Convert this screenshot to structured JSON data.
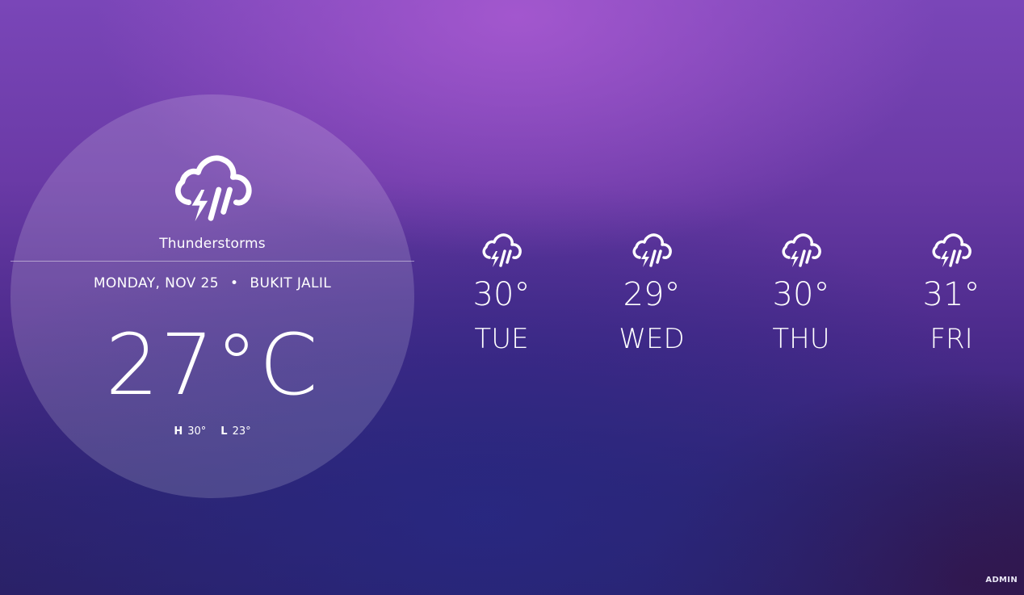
{
  "current": {
    "icon": "thunderstorm-icon",
    "condition": "Thunderstorms",
    "date": "MONDAY, NOV 25",
    "separator": "•",
    "location": "BUKIT JALIL",
    "temperature": "27°C",
    "high_label": "H",
    "high_value": "30°",
    "low_label": "L",
    "low_value": "23°"
  },
  "forecast": [
    {
      "day": "TUE",
      "temp": "30°",
      "icon": "thunderstorm-icon"
    },
    {
      "day": "WED",
      "temp": "29°",
      "icon": "thunderstorm-icon"
    },
    {
      "day": "THU",
      "temp": "30°",
      "icon": "thunderstorm-icon"
    },
    {
      "day": "FRI",
      "temp": "31°",
      "icon": "thunderstorm-icon"
    }
  ],
  "footer": {
    "admin_label": "ADMIN"
  },
  "colors": {
    "text": "#ffffff",
    "background_top": "#7a46b8",
    "background_bottom": "#2a2064"
  }
}
